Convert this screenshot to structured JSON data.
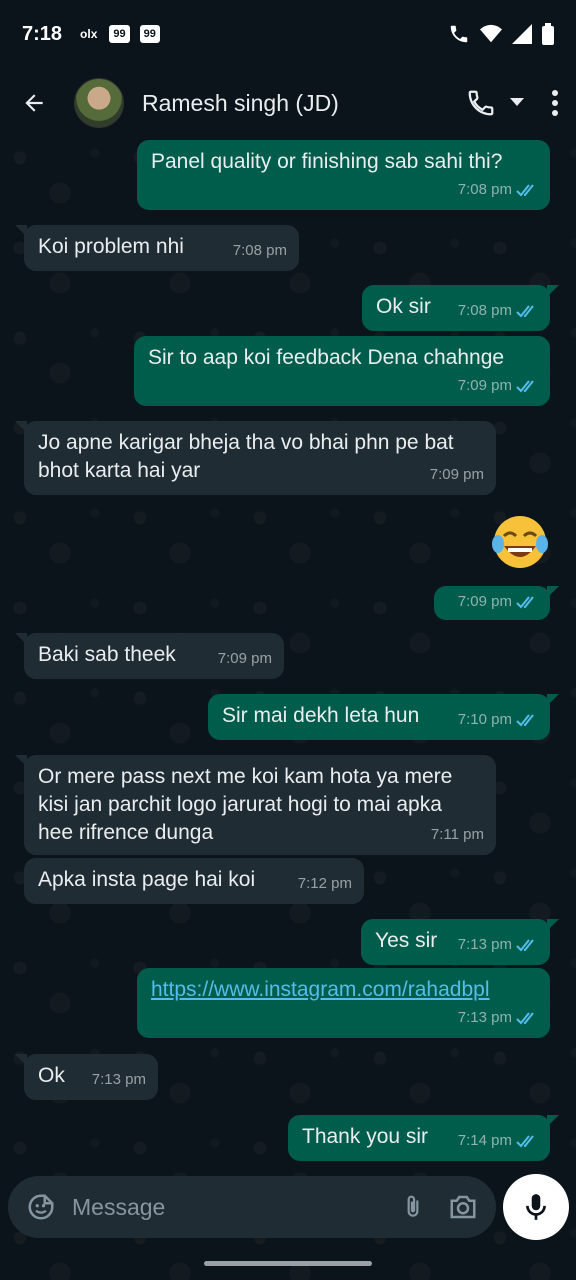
{
  "status_bar": {
    "time": "7:18",
    "olx": "olx",
    "badge1": "99",
    "badge2": "99"
  },
  "header": {
    "contact_name": "Ramesh singh (JD)"
  },
  "messages": [
    {
      "dir": "out",
      "text": "Panel quality or finishing sab sahi thi?",
      "time": "7:08 pm",
      "read": true
    },
    {
      "dir": "in",
      "text": "Koi problem nhi",
      "time": "7:08 pm"
    },
    {
      "dir": "out",
      "text": "Ok sir",
      "time": "7:08 pm",
      "read": true
    },
    {
      "dir": "out",
      "text": "Sir to aap koi feedback Dena chahnge",
      "time": "7:09 pm",
      "read": true
    },
    {
      "dir": "in",
      "text": "Jo apne karigar bheja tha vo bhai phn pe bat bhot karta hai yar",
      "time": "7:09 pm"
    },
    {
      "dir": "out",
      "text": "",
      "emoji": "face-with-tears-of-joy",
      "time": "7:09 pm",
      "read": true
    },
    {
      "dir": "in",
      "text": "Baki sab theek",
      "time": "7:09 pm"
    },
    {
      "dir": "out",
      "text": "Sir mai dekh leta hun",
      "time": "7:10 pm",
      "read": true
    },
    {
      "dir": "in",
      "text": "Or mere pass next me koi kam hota ya mere kisi jan parchit logo jarurat hogi to mai apka hee rifrence dunga",
      "time": "7:11 pm"
    },
    {
      "dir": "in",
      "text": "Apka insta page hai koi",
      "time": "7:12 pm"
    },
    {
      "dir": "out",
      "text": "Yes sir",
      "time": "7:13 pm",
      "read": true
    },
    {
      "dir": "out",
      "text": "https://www.instagram.com/rahadbpl",
      "time": "7:13 pm",
      "read": true,
      "link": true
    },
    {
      "dir": "in",
      "text": "Ok",
      "time": "7:13 pm"
    },
    {
      "dir": "out",
      "text": "Thank you sir",
      "time": "7:14 pm",
      "read": true
    }
  ],
  "composer": {
    "placeholder": "Message"
  },
  "colors": {
    "outgoing_bubble": "#005c4b",
    "incoming_bubble": "#202c33",
    "read_ticks": "#53bdeb",
    "link": "#53bdeb"
  }
}
